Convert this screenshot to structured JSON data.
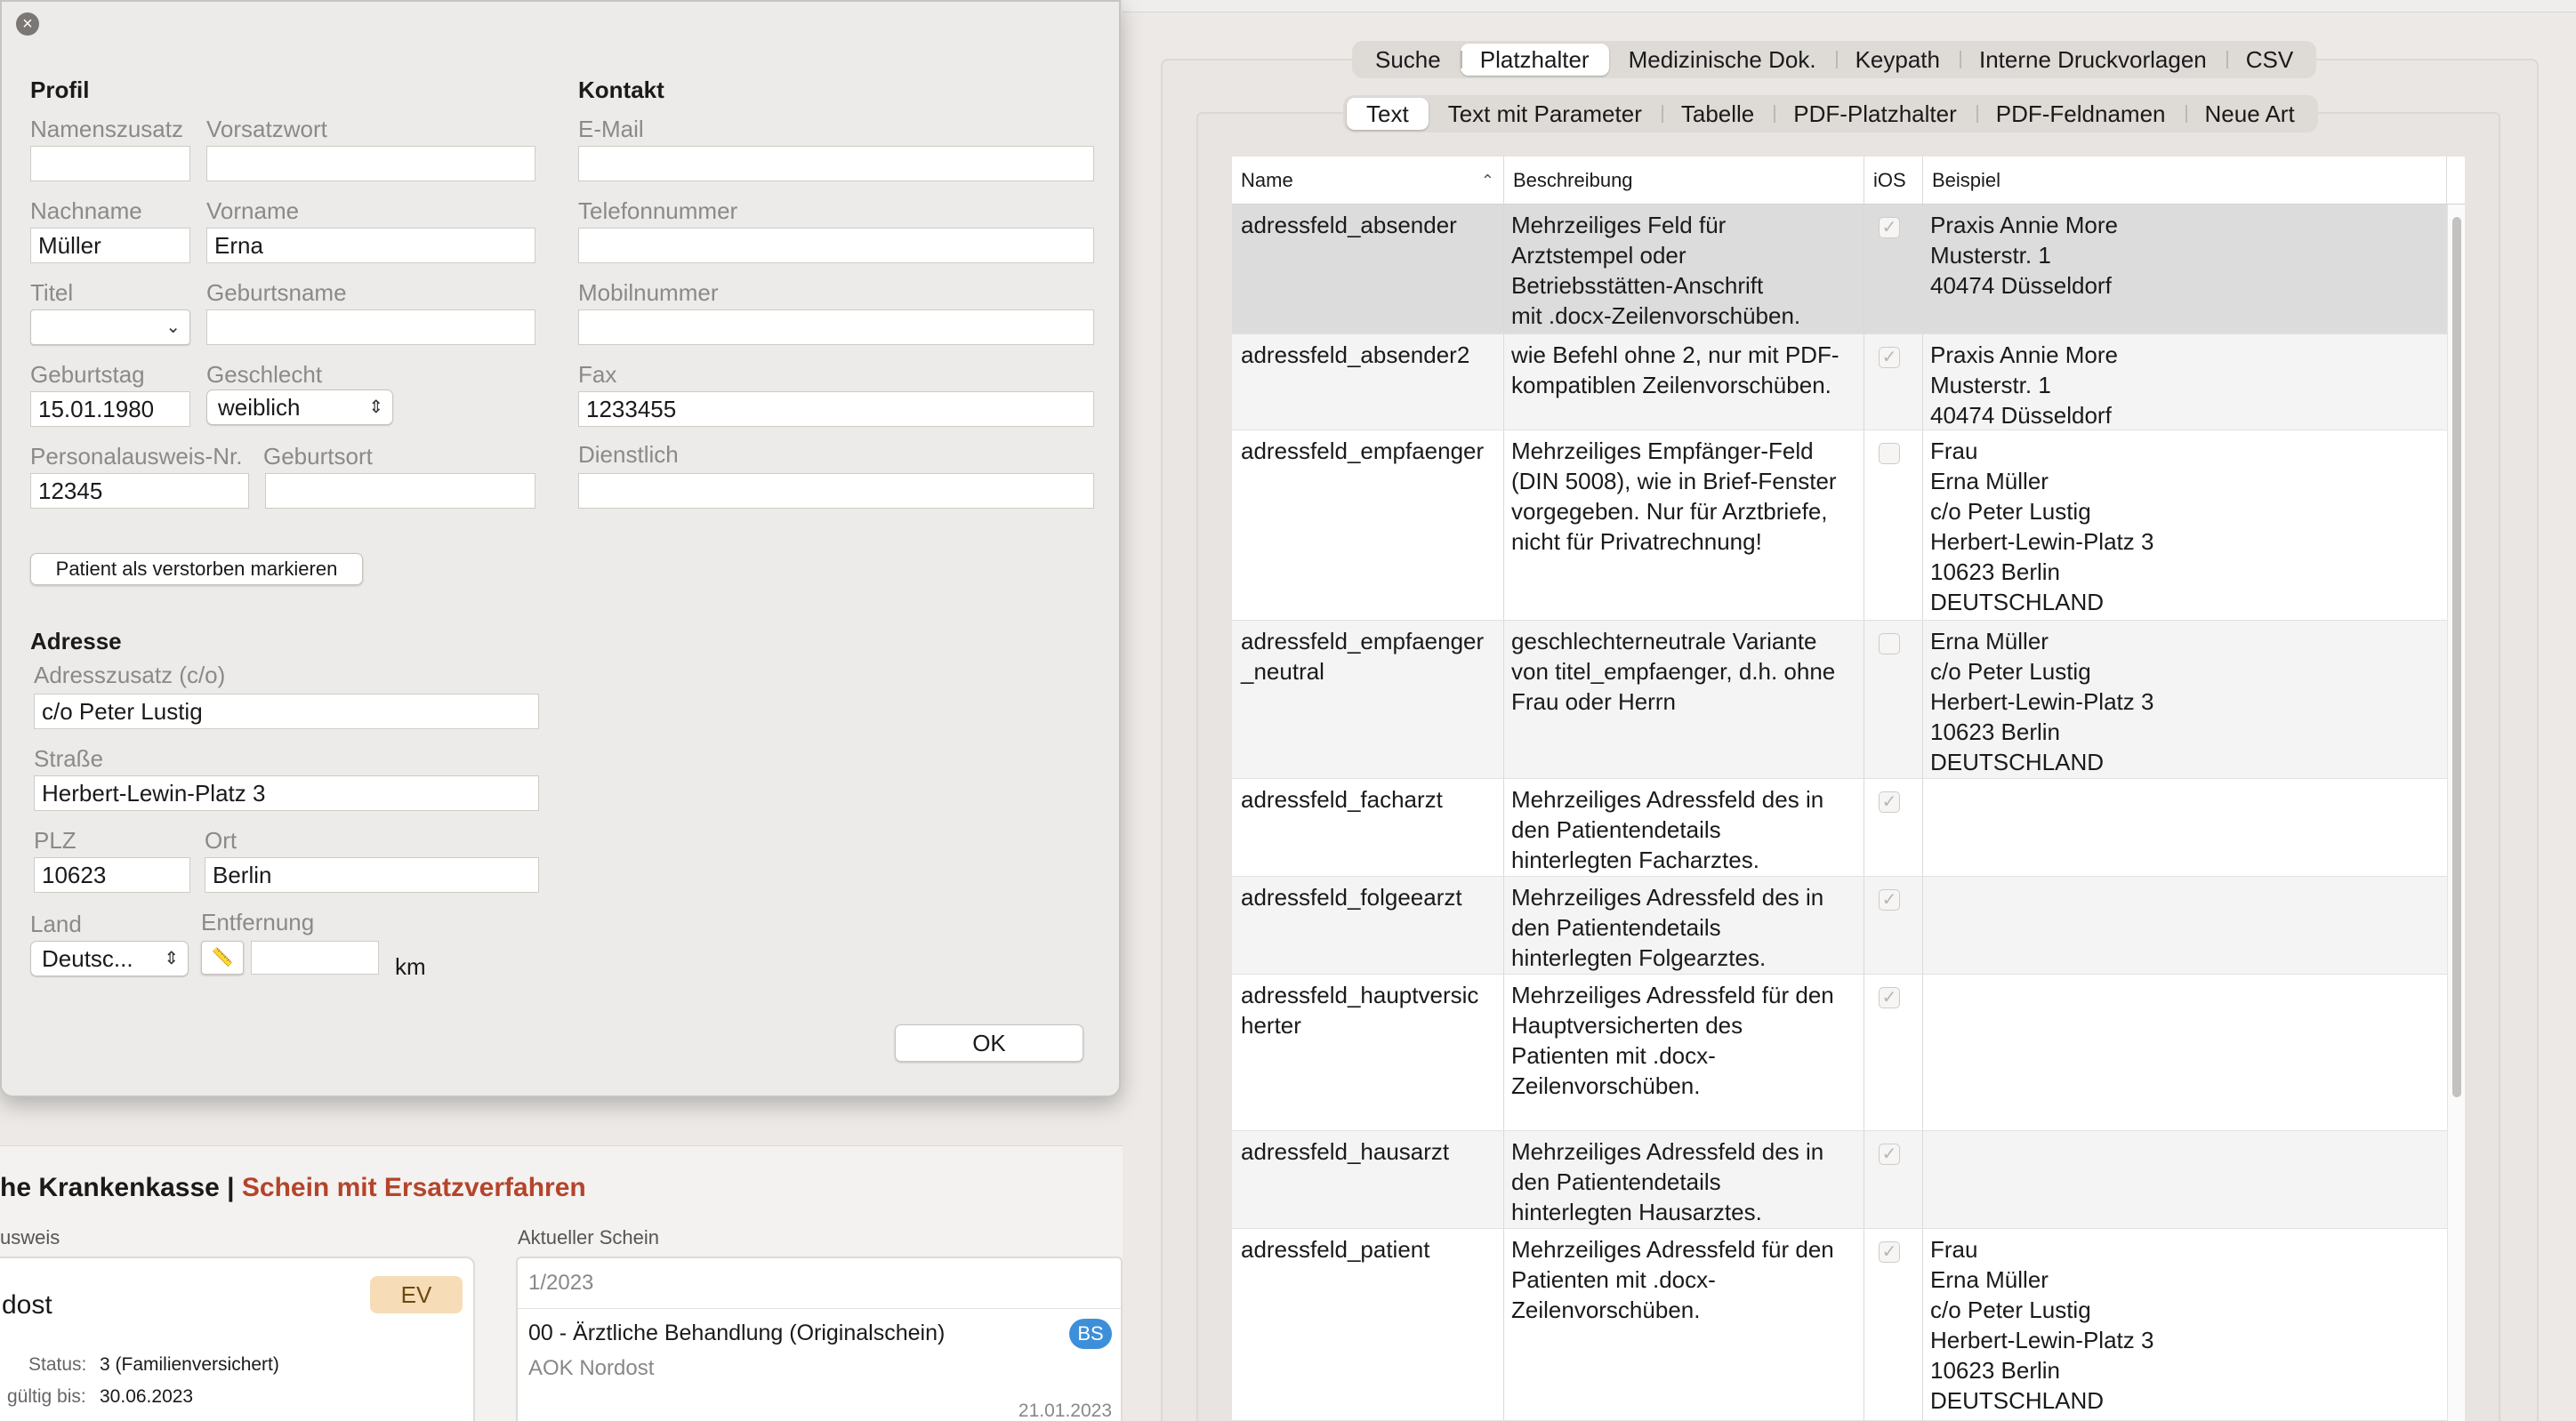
{
  "dialog": {
    "profile_heading": "Profil",
    "contact_heading": "Kontakt",
    "fields": {
      "namenszusatz": {
        "label": "Namenszusatz",
        "value": ""
      },
      "vorsatzwort": {
        "label": "Vorsatzwort",
        "value": ""
      },
      "nachname": {
        "label": "Nachname",
        "value": "Müller"
      },
      "vorname": {
        "label": "Vorname",
        "value": "Erna"
      },
      "titel": {
        "label": "Titel",
        "value": ""
      },
      "geburtsname": {
        "label": "Geburtsname",
        "value": ""
      },
      "geburtstag": {
        "label": "Geburtstag",
        "value": "15.01.1980"
      },
      "geschlecht": {
        "label": "Geschlecht",
        "value": "weiblich"
      },
      "ausweis": {
        "label": "Personalausweis-Nr.",
        "value": "12345"
      },
      "geburtsort": {
        "label": "Geburtsort",
        "value": ""
      },
      "email": {
        "label": "E-Mail",
        "value": ""
      },
      "telefon": {
        "label": "Telefonnummer",
        "value": ""
      },
      "mobil": {
        "label": "Mobilnummer",
        "value": ""
      },
      "fax": {
        "label": "Fax",
        "value": "1233455"
      },
      "dienstlich": {
        "label": "Dienstlich",
        "value": ""
      }
    },
    "deceased_button": "Patient als verstorben markieren",
    "address_heading": "Adresse",
    "address": {
      "co": {
        "label": "Adresszusatz (c/o)",
        "value": "c/o Peter Lustig"
      },
      "strasse": {
        "label": "Straße",
        "value": "Herbert-Lewin-Platz 3"
      },
      "plz": {
        "label": "PLZ",
        "value": "10623"
      },
      "ort": {
        "label": "Ort",
        "value": "Berlin"
      },
      "land": {
        "label": "Land",
        "value": "Deutsc..."
      },
      "entfernung": {
        "label": "Entfernung",
        "value": "",
        "unit": "km"
      }
    },
    "ok_button": "OK"
  },
  "bottom": {
    "title_prefix": "he Krankenkasse |",
    "title_accent": "Schein mit Ersatzverfahren",
    "accent_color": "#b5442a",
    "left_label": "usweis",
    "card_name": "dost",
    "ev_badge": "EV",
    "status_label": "Status:",
    "status_value": "3 (Familienversichert)",
    "valid_label": "gültig bis:",
    "valid_value": "30.06.2023",
    "current_label": "Aktueller Schein",
    "quarter": "1/2023",
    "schein_title": "00 - Ärztliche Behandlung (Originalschein)",
    "bs_badge": "BS",
    "kasse": "AOK Nordost",
    "date": "21.01.2023"
  },
  "tabs_top": [
    "Suche",
    "Platzhalter",
    "Medizinische Dok.",
    "Keypath",
    "Interne Druckvorlagen",
    "CSV"
  ],
  "tabs_sub": [
    "Text",
    "Text mit Parameter",
    "Tabelle",
    "PDF-Platzhalter",
    "PDF-Feldnamen",
    "Neue Art"
  ],
  "table": {
    "headers": {
      "name": "Name",
      "desc": "Beschreibung",
      "ios": "iOS",
      "example": "Beispiel"
    },
    "rows": [
      {
        "name": "adressfeld_absender",
        "desc": "Mehrzeiliges Feld für\nArztstempel oder\nBetriebsstätten-Anschrift\nmit .docx-Zeilenvorschüben.",
        "ios": true,
        "example": "Praxis Annie More\nMusterstr. 1\n40474 Düsseldorf"
      },
      {
        "name": "adressfeld_absender2",
        "desc": "wie Befehl ohne 2, nur mit PDF-\nkompatiblen Zeilenvorschüben.",
        "ios": true,
        "example": "Praxis Annie More\nMusterstr. 1\n40474 Düsseldorf"
      },
      {
        "name": "adressfeld_empfaenger",
        "desc": "Mehrzeiliges Empfänger-Feld\n(DIN 5008), wie in Brief-Fenster\nvorgegeben. Nur für Arztbriefe,\nnicht für Privatrechnung!",
        "ios": false,
        "example": "Frau\nErna Müller\nc/o Peter Lustig\nHerbert-Lewin-Platz 3\n10623 Berlin\nDEUTSCHLAND"
      },
      {
        "name": "adressfeld_empfaenger\n_neutral",
        "desc": "geschlechterneutrale Variante\nvon  titel_empfaenger, d.h. ohne\nFrau oder Herrn",
        "ios": false,
        "example": "Erna Müller\nc/o Peter Lustig\nHerbert-Lewin-Platz 3\n10623 Berlin\nDEUTSCHLAND"
      },
      {
        "name": "adressfeld_facharzt",
        "desc": "Mehrzeiliges Adressfeld des in\nden Patientendetails\nhinterlegten Facharztes.",
        "ios": true,
        "example": ""
      },
      {
        "name": "adressfeld_folgeearzt",
        "desc": "Mehrzeiliges Adressfeld des in\nden Patientendetails\nhinterlegten Folgearztes.",
        "ios": true,
        "example": ""
      },
      {
        "name": "adressfeld_hauptversic\nherter",
        "desc": "Mehrzeiliges Adressfeld für den\nHauptversicherten des\nPatienten mit .docx-\nZeilenvorschüben.",
        "ios": true,
        "example": ""
      },
      {
        "name": "adressfeld_hausarzt",
        "desc": "Mehrzeiliges Adressfeld des in\nden Patientendetails\nhinterlegten Hausarztes.",
        "ios": true,
        "example": ""
      },
      {
        "name": "adressfeld_patient",
        "desc": "Mehrzeiliges Adressfeld für den\nPatienten mit .docx-\nZeilenvorschüben.",
        "ios": true,
        "example": "Frau\nErna Müller\nc/o Peter Lustig\nHerbert-Lewin-Platz 3\n10623 Berlin\nDEUTSCHLAND"
      }
    ]
  }
}
